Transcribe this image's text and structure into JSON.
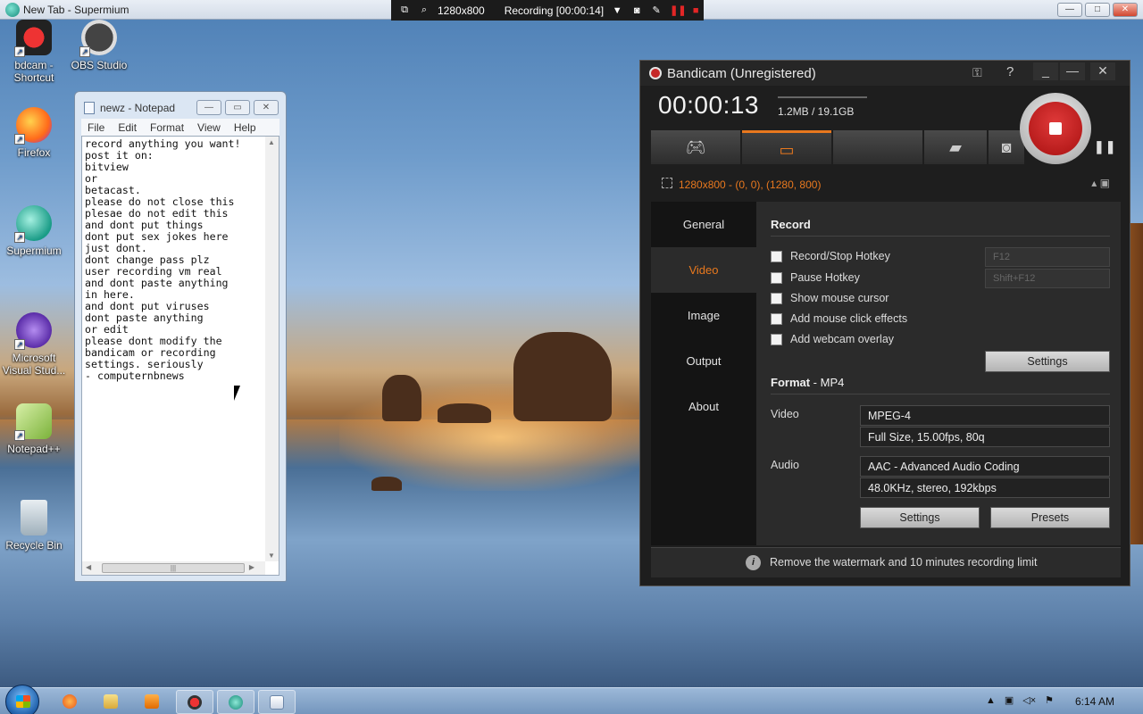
{
  "browser": {
    "title": "New Tab - Supermium",
    "min": "—",
    "max": "□",
    "close": "✕"
  },
  "recorder_bar": {
    "resolution": "1280x800",
    "status": "Recording [00:00:14]"
  },
  "desktop_icons": [
    {
      "label": "bdcam - Shortcut",
      "icon": "bandicam-icon",
      "color": "#c41d1d"
    },
    {
      "label": "OBS Studio",
      "icon": "obs-icon",
      "color": "#2e2e2e"
    },
    {
      "label": "Firefox",
      "icon": "firefox-icon",
      "color": "#ff7a1a"
    },
    {
      "label": "Supermium",
      "icon": "supermium-icon",
      "color": "#2bb5a0"
    },
    {
      "label": "Microsoft Visual Stud...",
      "icon": "visual-studio-icon",
      "color": "#7a4fc7"
    },
    {
      "label": "Notepad++",
      "icon": "notepadpp-icon",
      "color": "#8bc34a"
    },
    {
      "label": "Recycle Bin",
      "icon": "recycle-bin-icon",
      "color": "#cfd8dc"
    }
  ],
  "notepad": {
    "title": "newz - Notepad",
    "menu": [
      "File",
      "Edit",
      "Format",
      "View",
      "Help"
    ],
    "text": "record anything you want!\npost it on:\nbitview\nor\nbetacast.\nplease do not close this\nplesae do not edit this\nand dont put things\ndont put sex jokes here\njust dont.\ndont change pass plz\nuser recording vm real\nand dont paste anything\nin here.\nand dont put viruses\ndont paste anything\nor edit\nplease dont modify the\nbandicam or recording\nsettings. seriously\n- computernbnews"
  },
  "bandicam": {
    "title": "Bandicam (Unregistered)",
    "timer": "00:00:13",
    "size": "1.2MB / 19.1GB",
    "area_text": "1280x800 - (0, 0), (1280, 800)",
    "nav": [
      "General",
      "Video",
      "Image",
      "Output",
      "About"
    ],
    "active_nav": "Video",
    "record_header": "Record",
    "checkboxes": [
      "Record/Stop Hotkey",
      "Pause Hotkey",
      "Show mouse cursor",
      "Add mouse click effects",
      "Add webcam overlay"
    ],
    "hotkey1": "F12",
    "hotkey2": "Shift+F12",
    "settings_button": "Settings",
    "format_header": "Format",
    "format_value": " - MP4",
    "video_label": "Video",
    "video_codec": "MPEG-4",
    "video_detail": "Full Size, 15.00fps, 80q",
    "audio_label": "Audio",
    "audio_codec": "AAC - Advanced Audio Coding",
    "audio_detail": "48.0KHz, stereo, 192kbps",
    "format_settings_button": "Settings",
    "presets_button": "Presets",
    "notice": "Remove the watermark and 10 minutes recording limit",
    "accent": "#e8781e"
  },
  "taskbar": {
    "clock": "6:14 AM"
  }
}
